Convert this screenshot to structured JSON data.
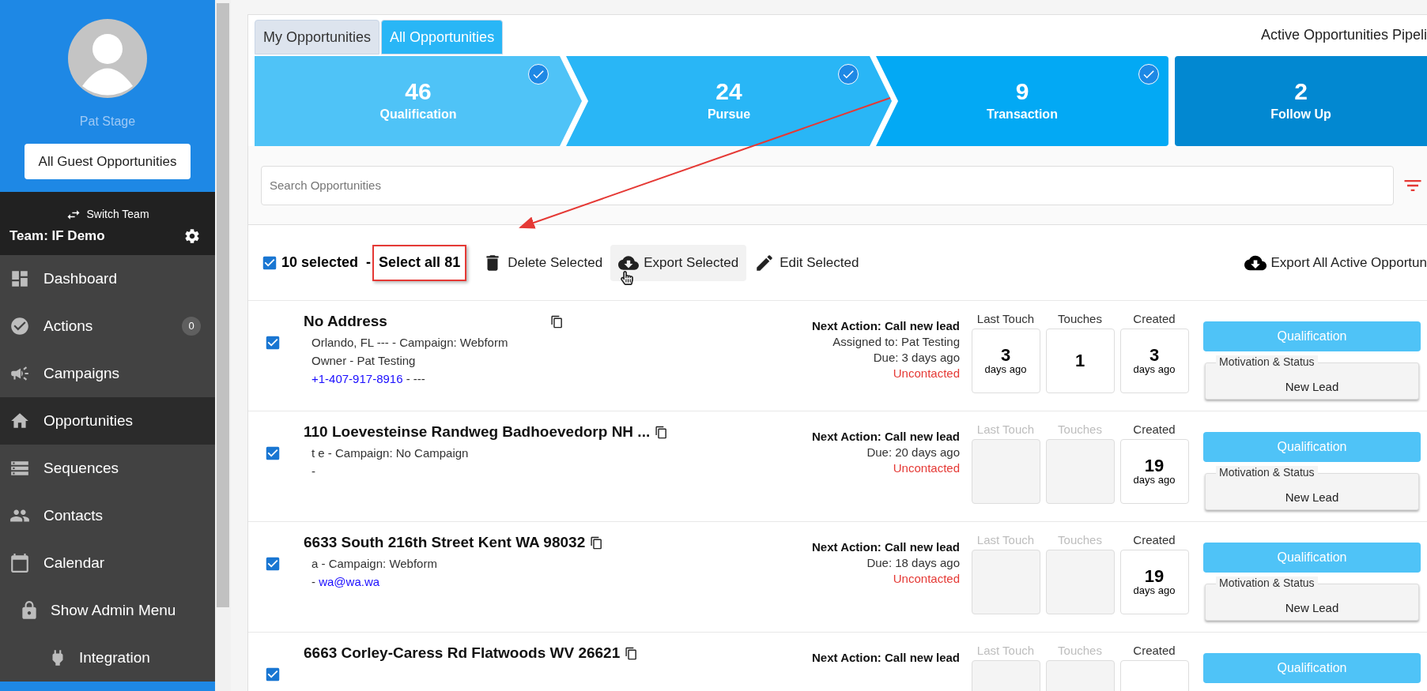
{
  "sidebar": {
    "user_name": "Pat Stage",
    "guest_button": "All Guest Opportunities",
    "switch_team": "Switch Team",
    "team": "Team: IF Demo",
    "nav": [
      {
        "label": "Dashboard",
        "selected": false
      },
      {
        "label": "Actions",
        "selected": false,
        "badge": "0"
      },
      {
        "label": "Campaigns",
        "selected": false
      },
      {
        "label": "Opportunities",
        "selected": true
      },
      {
        "label": "Sequences",
        "selected": false
      },
      {
        "label": "Contacts",
        "selected": false
      },
      {
        "label": "Calendar",
        "selected": false
      },
      {
        "label": "Show Admin Menu",
        "selected": false,
        "children": [
          {
            "label": "Integration",
            "selected": false
          }
        ]
      }
    ]
  },
  "tabs": [
    {
      "label": "My Opportunities",
      "selected": false
    },
    {
      "label": "All Opportunities",
      "selected": true
    }
  ],
  "pipeline_title": "Active Opportunities Pipeli",
  "stages": [
    {
      "count": "46",
      "label": "Qualification",
      "checked": true
    },
    {
      "count": "24",
      "label": "Pursue",
      "checked": true
    },
    {
      "count": "9",
      "label": "Transaction",
      "checked": true
    },
    {
      "count": "2",
      "label": "Follow Up",
      "checked": false
    }
  ],
  "search": {
    "placeholder": "Search Opportunities"
  },
  "toolbar": {
    "all_checked": true,
    "selected_count": "10 selected",
    "separator": "-",
    "select_all": "Select all 81",
    "actions": [
      {
        "label": "Delete Selected",
        "hovered": false
      },
      {
        "label": "Export Selected",
        "hovered": true
      },
      {
        "label": "Edit Selected",
        "hovered": false
      }
    ],
    "export_all": "Export All Active Opportun"
  },
  "rows": [
    {
      "checked": true,
      "title": "No Address",
      "lines": [
        {
          "text": "Orlando, FL --- - Campaign: Webform"
        },
        {
          "text": "Owner - Pat Testing"
        },
        {
          "link": "+1-407-917-8916",
          "suffix": " - ---"
        }
      ],
      "next_action": "Next Action: Call new lead",
      "details": [
        "Assigned to: Pat Testing",
        "Due: 3 days ago"
      ],
      "status": "Uncontacted",
      "metrics": [
        {
          "label": "Last Touch",
          "value": "3",
          "unit": "days ago"
        },
        {
          "label": "Touches",
          "value": "1"
        },
        {
          "label": "Created",
          "value": "3",
          "unit": "days ago"
        }
      ],
      "stage": "Qualification",
      "motivation_label": "Motivation & Status",
      "motivation": "New Lead"
    },
    {
      "checked": true,
      "title": "110 Loevesteinse Randweg Badhoevedorp NH ...",
      "lines": [
        {
          "text": "t e - Campaign: No Campaign"
        },
        {
          "text": "-"
        }
      ],
      "next_action": "Next Action: Call new lead",
      "details": [
        "Due: 20 days ago"
      ],
      "status": "Uncontacted",
      "metrics": [
        {
          "label": "Last Touch"
        },
        {
          "label": "Touches"
        },
        {
          "label": "Created",
          "value": "19",
          "unit": "days ago"
        }
      ],
      "stage": "Qualification",
      "motivation_label": "Motivation & Status",
      "motivation": "New Lead"
    },
    {
      "checked": true,
      "title": "6633 South 216th Street Kent WA 98032",
      "lines": [
        {
          "text": "a - Campaign: Webform"
        },
        {
          "prefix": "- ",
          "link": "wa@wa.wa"
        }
      ],
      "next_action": "Next Action: Call new lead",
      "details": [
        "Due: 18 days ago"
      ],
      "status": "Uncontacted",
      "metrics": [
        {
          "label": "Last Touch"
        },
        {
          "label": "Touches"
        },
        {
          "label": "Created",
          "value": "19",
          "unit": "days ago"
        }
      ],
      "stage": "Qualification",
      "motivation_label": "Motivation & Status",
      "motivation": "New Lead"
    },
    {
      "checked": true,
      "title": "6663 Corley-Caress Rd Flatwoods WV 26621",
      "lines": [],
      "next_action": "Next Action: Call new lead",
      "details": [],
      "metrics": [
        {
          "label": "Last Touch"
        },
        {
          "label": "Touches"
        },
        {
          "label": "Created"
        }
      ],
      "stage": "Qualification"
    }
  ]
}
